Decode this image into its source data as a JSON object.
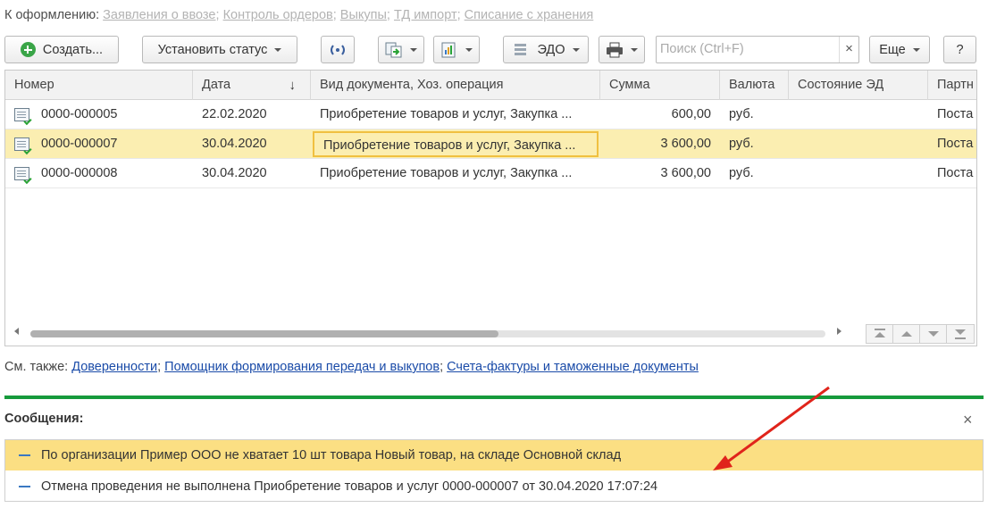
{
  "top_bar": {
    "prefix": "К оформлению:",
    "links": [
      "Заявления о ввозе",
      "Контроль ордеров",
      "Выкупы",
      "ТД импорт",
      "Списание с хранения"
    ],
    "separator": ";"
  },
  "toolbar": {
    "create_label": "Создать...",
    "set_status_label": "Установить статус",
    "edo_label": "ЭДО",
    "search_placeholder": "Поиск (Ctrl+F)",
    "clear_label": "×",
    "more_label": "Еще",
    "help_label": "?"
  },
  "table": {
    "columns": [
      "Номер",
      "Дата",
      "Вид документа, Хоз. операция",
      "Сумма",
      "Валюта",
      "Состояние ЭД",
      "Партн"
    ],
    "sort_indicator": "↓",
    "rows": [
      {
        "number": "0000-000005",
        "date": "22.02.2020",
        "type": "Приобретение товаров и услуг, Закупка ...",
        "sum": "600,00",
        "currency": "руб.",
        "state": "",
        "partner": "Поста"
      },
      {
        "number": "0000-000007",
        "date": "30.04.2020",
        "type": "Приобретение товаров и услуг, Закупка ...",
        "sum": "3 600,00",
        "currency": "руб.",
        "state": "",
        "partner": "Поста"
      },
      {
        "number": "0000-000008",
        "date": "30.04.2020",
        "type": "Приобретение товаров и услуг, Закупка ...",
        "sum": "3 600,00",
        "currency": "руб.",
        "state": "",
        "partner": "Поста"
      }
    ],
    "selected_row": 1
  },
  "see_also": {
    "prefix": "См. также:",
    "links": [
      "Доверенности",
      "Помощник формирования передач и выкупов",
      "Счета-фактуры и таможенные документы"
    ],
    "separator": ";"
  },
  "messages": {
    "title": "Сообщения:",
    "close_label": "×",
    "items": [
      "По организации Пример ООО не хватает 10 шт товара Новый товар, на складе Основной склад",
      "Отмена проведения не выполнена Приобретение товаров и услуг 0000-000007 от 30.04.2020 17:07:24"
    ]
  },
  "colors": {
    "accent_green": "#169a3c",
    "selected_row": "#fbeeb1",
    "message_highlight": "#fbdf83",
    "link_blue": "#1a4ba8",
    "annotation_arrow": "#e0241b"
  }
}
